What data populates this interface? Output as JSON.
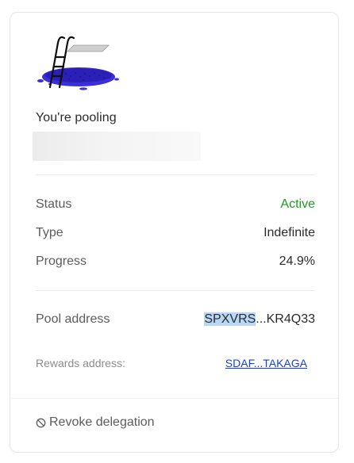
{
  "card": {
    "pooling_label": "You're pooling",
    "details": {
      "status_label": "Status",
      "status_value": "Active",
      "type_label": "Type",
      "type_value": "Indefinite",
      "progress_label": "Progress",
      "progress_value": "24.9%"
    },
    "pool_address": {
      "label": "Pool address",
      "value_highlighted": "SPXVRS",
      "value_rest": "...KR4Q33"
    },
    "rewards_address": {
      "label": "Rewards address:",
      "value": "SDAF...TAKAGA"
    },
    "revoke_label": "Revoke delegation",
    "colors": {
      "active": "#1e9a1e",
      "link": "#1a3fd9",
      "pool_water": "#3a2fd8"
    },
    "icons": {
      "illustration": "pool-ladder-illustration",
      "revoke": "ban-icon"
    }
  }
}
